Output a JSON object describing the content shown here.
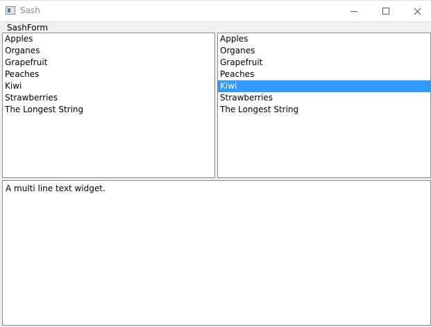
{
  "window": {
    "title": "Sash",
    "buttons": {
      "minimize": "minimize-icon",
      "maximize": "maximize-icon",
      "close": "close-icon"
    }
  },
  "menubar": {
    "label": "SashForm"
  },
  "left_list": {
    "items": [
      "Apples",
      "Organes",
      "Grapefruit",
      "Peaches",
      "Kiwi",
      "Strawberries",
      "The Longest String"
    ],
    "selected_index": -1
  },
  "right_list": {
    "items": [
      "Apples",
      "Organes",
      "Grapefruit",
      "Peaches",
      "Kiwi",
      "Strawberries",
      "The Longest String"
    ],
    "selected_index": 4
  },
  "text_widget": {
    "value": "A multi line text widget."
  },
  "colors": {
    "selection": "#3399ff",
    "selection_text": "#ffffff"
  }
}
